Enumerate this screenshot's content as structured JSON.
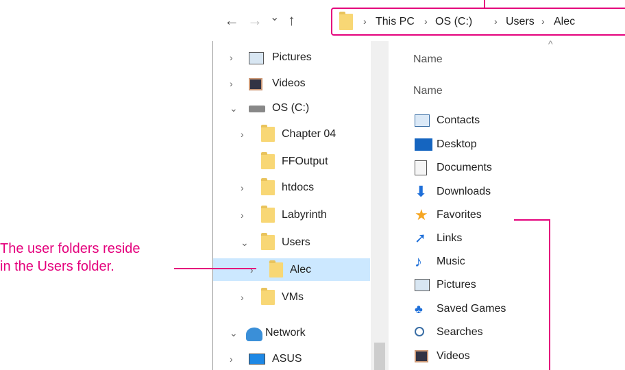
{
  "toolbar": {
    "back_icon": "←",
    "forward_icon": "→",
    "recent_icon": "⌄",
    "up_icon": "↑"
  },
  "breadcrumb": {
    "sep": "›",
    "items": [
      "This PC",
      "OS (C:)",
      "Users",
      "Alec"
    ]
  },
  "nav_pane": {
    "items": [
      {
        "label": "Pictures"
      },
      {
        "label": "Videos"
      },
      {
        "label": "OS (C:)"
      },
      {
        "label": "Chapter 04"
      },
      {
        "label": "FFOutput"
      },
      {
        "label": "htdocs"
      },
      {
        "label": "Labyrinth"
      },
      {
        "label": "Users"
      },
      {
        "label": "Alec"
      },
      {
        "label": "VMs"
      },
      {
        "label": "Network"
      },
      {
        "label": "ASUS"
      }
    ],
    "chev_right": "›",
    "chev_down": "⌄",
    "scroll_up": "^"
  },
  "content": {
    "sort_indicator": "^",
    "header_top": "Name",
    "header": "Name",
    "files": [
      {
        "label": "Contacts"
      },
      {
        "label": "Desktop"
      },
      {
        "label": "Documents"
      },
      {
        "label": "Downloads"
      },
      {
        "label": "Favorites"
      },
      {
        "label": "Links"
      },
      {
        "label": "Music"
      },
      {
        "label": "Pictures"
      },
      {
        "label": "Saved Games"
      },
      {
        "label": "Searches"
      },
      {
        "label": "Videos"
      }
    ]
  },
  "callouts": {
    "users_line1": "The user folders reside",
    "users_line2": "in the Users folder."
  },
  "colors": {
    "accent": "#e4007c",
    "selection": "#cce8ff",
    "folder": "#f8d775"
  }
}
